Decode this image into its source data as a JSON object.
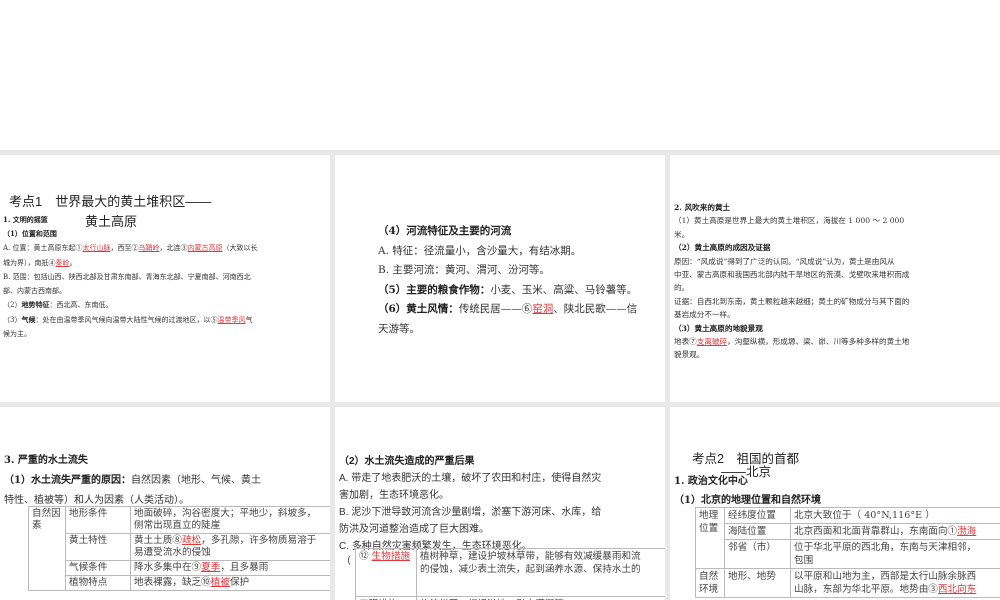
{
  "colors": {
    "accent": "#e0393e",
    "gutter": "#e8e8e8"
  },
  "s1": {
    "title1": "考点1　世界最大的黄土堆积区——",
    "title2": "黄土高原",
    "h1": "1. 文明的摇篮",
    "lines": [
      {
        "b": true,
        "segs": [
          {
            "t": "（1）位置和范围"
          }
        ]
      },
      {
        "segs": [
          {
            "t": "A. 位置：黄土高原东起①"
          },
          {
            "t": "太行山脉",
            "u": true
          },
          {
            "t": "，西至②"
          },
          {
            "t": "乌鞘岭",
            "u": true
          },
          {
            "t": "，北连③"
          },
          {
            "t": "内蒙古高原",
            "u": true
          },
          {
            "t": "（大致以长"
          }
        ]
      },
      {
        "segs": [
          {
            "t": "城为界），南抵④"
          },
          {
            "t": "秦岭",
            "u": true
          },
          {
            "t": "。"
          }
        ]
      },
      {
        "segs": [
          {
            "t": "B. 范围：包括山西、陕西北部及甘肃东南部、青海东北部、宁夏南部、河南西北"
          }
        ]
      },
      {
        "segs": [
          {
            "t": "部、内蒙古西南部。"
          }
        ]
      },
      {
        "segs": [
          {
            "t": "（2）"
          },
          {
            "t": "地势特征",
            "b": true
          },
          {
            "t": "：西北高、东南低。"
          }
        ]
      },
      {
        "segs": [
          {
            "t": "（3）"
          },
          {
            "t": "气候",
            "b": true
          },
          {
            "t": "：处在由温带季风气候向温带大陆性气候的过渡地区，以⑤"
          },
          {
            "t": "温带季风",
            "u": true
          },
          {
            "t": "气"
          }
        ]
      },
      {
        "segs": [
          {
            "t": "候为主。"
          }
        ]
      }
    ]
  },
  "s2": {
    "lines": [
      {
        "segs": [
          {
            "t": "（4）河流特征及主要的河流",
            "b": true
          }
        ]
      },
      {
        "segs": [
          {
            "t": "A. 特征：径流量小，含沙量大，有结冰期。"
          }
        ]
      },
      {
        "segs": [
          {
            "t": "B. 主要河流：黄河、渭河、汾河等。"
          }
        ]
      },
      {
        "segs": [
          {
            "t": "（5）主要的粮食作物：",
            "b": true
          },
          {
            "t": "小麦、玉米、高粱、马铃薯等。"
          }
        ]
      },
      {
        "segs": [
          {
            "t": "（6）黄土风情：",
            "b": true
          },
          {
            "t": "传统民居——⑥"
          },
          {
            "t": "窑洞",
            "u": true
          },
          {
            "t": "、陕北民歌——信"
          }
        ]
      },
      {
        "segs": [
          {
            "t": "天游等。"
          }
        ]
      }
    ]
  },
  "s3": {
    "lines": [
      {
        "segs": [
          {
            "t": "2. 风吹来的黄土",
            "b": true
          }
        ]
      },
      {
        "segs": [
          {
            "t": "（1）黄土高原是世界上最大的黄土堆积区，海拔在 1 000 ～ 2 000"
          }
        ]
      },
      {
        "segs": [
          {
            "t": "米。"
          }
        ]
      },
      {
        "segs": [
          {
            "t": "（2）黄土高原的成因及证据",
            "b": true
          }
        ]
      },
      {
        "segs": [
          {
            "t": "原因：“风成说”得到了广泛的认同。“风成说”认为，黄土是由风从"
          }
        ]
      },
      {
        "segs": [
          {
            "t": "中亚、蒙古高原和我国西北部内陆干旱地区的荒漠、戈壁吹来堆积而成"
          }
        ]
      },
      {
        "segs": [
          {
            "t": "的。"
          }
        ]
      },
      {
        "segs": [
          {
            "t": "证据：自西北到东南，黄土颗粒越来越细；黄土的矿物成分与其下面的"
          }
        ]
      },
      {
        "segs": [
          {
            "t": "基岩成分不一样。"
          }
        ]
      },
      {
        "segs": [
          {
            "t": "（3）黄土高原的地貌景观",
            "b": true
          }
        ]
      },
      {
        "segs": [
          {
            "t": "地表⑦"
          },
          {
            "t": "支离破碎",
            "u": true
          },
          {
            "t": "，沟壑纵横，形成塬、梁、峁、川等多种多样的黄土地"
          }
        ]
      },
      {
        "segs": [
          {
            "t": "貌景观。"
          }
        ]
      }
    ]
  },
  "s4": {
    "lines": [
      {
        "segs": [
          {
            "t": "3. 严重的水土流失",
            "b": true
          }
        ]
      },
      {
        "segs": [
          {
            "t": "（1）水土流失严重的原因：",
            "b": true
          },
          {
            "t": "自然因素（地形、气候、黄土"
          }
        ]
      },
      {
        "segs": [
          {
            "t": "特性、植被等）和人为因素（人类活动）。"
          }
        ]
      }
    ],
    "table": {
      "group": "自然因素",
      "rows": [
        {
          "k": "地形条件",
          "segs": [
            {
              "t": "地面破碎，沟谷密度大；平地少，斜坡多，"
            },
            {
              "t": "侧常出现直立的陡崖",
              "br": true
            }
          ]
        },
        {
          "k": "黄土特性",
          "segs": [
            {
              "t": "黄土土质⑧"
            },
            {
              "t": "疏松",
              "u": true
            },
            {
              "t": "，多孔隙，许多物质易溶于"
            },
            {
              "t": "易遭受流水的侵蚀",
              "br": true
            }
          ]
        },
        {
          "k": "气候条件",
          "segs": [
            {
              "t": "降水多集中在⑨"
            },
            {
              "t": "夏季",
              "u": true
            },
            {
              "t": "，且多暴雨"
            }
          ]
        },
        {
          "k": "植物特点",
          "segs": [
            {
              "t": "地表裸露，缺乏⑩"
            },
            {
              "t": "植被",
              "u": true
            },
            {
              "t": "保护"
            }
          ]
        }
      ]
    }
  },
  "s5": {
    "lines": [
      {
        "segs": [
          {
            "t": "（2）水土流失造成的严重后果",
            "b": true
          }
        ]
      },
      {
        "segs": [
          {
            "t": "A. 带走了地表肥沃的土壤，破坏了农田和村庄，使得自然灾"
          }
        ]
      },
      {
        "segs": [
          {
            "t": "害加剧，生态环境恶化。"
          }
        ]
      },
      {
        "segs": [
          {
            "t": "B. 泥沙下泄导致河流含沙量剧增，淤塞下游河床、水库，给"
          }
        ]
      },
      {
        "segs": [
          {
            "t": "防洪及河道整治造成了巨大困难。"
          }
        ]
      },
      {
        "segs": [
          {
            "t": "C. 多种自然灾害频繁发生，生态环境恶化。"
          }
        ]
      }
    ],
    "paren": "（",
    "table": {
      "rows": [
        {
          "kpre": "⑫ ",
          "k": "生物措施",
          "v": "植树种草，建设护坡林草带，能够有效减缓暴雨和流",
          "v2": "的侵蚀，减少表土流失，起到涵养水源、保持水土的"
        },
        {
          "k": "工程措施",
          "v": "修筑梯田、打坝淤地、引水灌溉等"
        }
      ]
    }
  },
  "s6": {
    "title1": "考点2　祖国的首都",
    "title2": "——北京",
    "h1": "1. 政治文化中心",
    "h2": "（1）北京的地理位置和自然环境",
    "table": {
      "rows": [
        {
          "g": "地理位置",
          "k": "经纬度位置",
          "segs": [
            {
              "t": "北京大致位于（ 40°N,116°E ）"
            }
          ]
        },
        {
          "k": "海陆位置",
          "segs": [
            {
              "t": "北京西面和北面背靠群山，东南面向①"
            },
            {
              "t": "渤海",
              "u": true
            }
          ]
        },
        {
          "k": "邻省（市）",
          "segs": [
            {
              "t": "位于华北平原的西北角，东南与天津相邻，"
            },
            {
              "t": "包围",
              "br": true
            }
          ]
        },
        {
          "g": "自然环境",
          "k": "地形、地势",
          "segs": [
            {
              "t": "以平原和山地为主，西部是太行山脉余脉西"
            },
            {
              "t": "山脉，东部为华北平原。地势由③",
              "br": true
            },
            {
              "t": "西北向东",
              "u": true
            }
          ]
        }
      ]
    }
  }
}
